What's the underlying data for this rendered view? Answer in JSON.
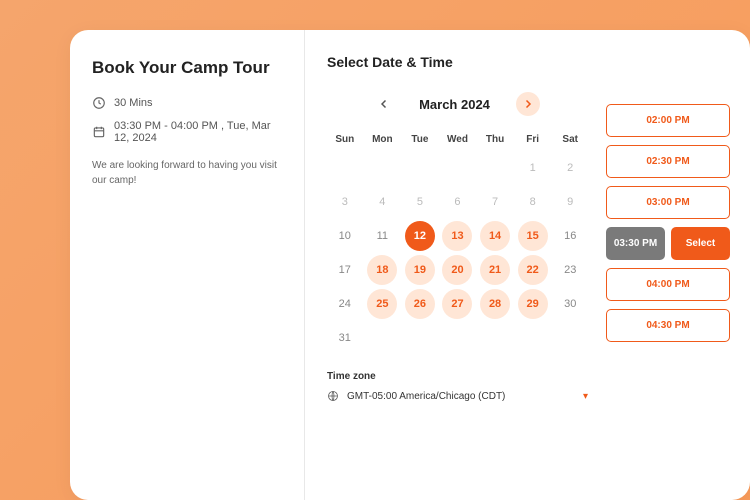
{
  "left": {
    "title": "Book Your Camp Tour",
    "duration": "30 Mins",
    "datetime": "03:30 PM - 04:00 PM , Tue, Mar 12, 2024",
    "desc": "We are looking forward to having you visit our camp!"
  },
  "right": {
    "heading": "Select Date & Time",
    "month": "March 2024",
    "weekdays": [
      "Sun",
      "Mon",
      "Tue",
      "Wed",
      "Thu",
      "Fri",
      "Sat"
    ],
    "tz_label": "Time zone",
    "tz_value": "GMT-05:00 America/Chicago (CDT)"
  },
  "days": [
    {
      "n": "",
      "cls": "empty"
    },
    {
      "n": "",
      "cls": "empty"
    },
    {
      "n": "",
      "cls": "empty"
    },
    {
      "n": "",
      "cls": "empty"
    },
    {
      "n": "",
      "cls": "empty"
    },
    {
      "n": "1",
      "cls": "muted"
    },
    {
      "n": "2",
      "cls": "muted"
    },
    {
      "n": "3",
      "cls": "muted"
    },
    {
      "n": "4",
      "cls": "muted"
    },
    {
      "n": "5",
      "cls": "muted"
    },
    {
      "n": "6",
      "cls": "muted"
    },
    {
      "n": "7",
      "cls": "muted"
    },
    {
      "n": "8",
      "cls": "muted"
    },
    {
      "n": "9",
      "cls": "muted"
    },
    {
      "n": "10",
      "cls": "normal"
    },
    {
      "n": "11",
      "cls": "normal"
    },
    {
      "n": "12",
      "cls": "selected"
    },
    {
      "n": "13",
      "cls": "avail"
    },
    {
      "n": "14",
      "cls": "avail"
    },
    {
      "n": "15",
      "cls": "avail"
    },
    {
      "n": "16",
      "cls": "normal"
    },
    {
      "n": "17",
      "cls": "normal"
    },
    {
      "n": "18",
      "cls": "avail"
    },
    {
      "n": "19",
      "cls": "avail"
    },
    {
      "n": "20",
      "cls": "avail"
    },
    {
      "n": "21",
      "cls": "avail"
    },
    {
      "n": "22",
      "cls": "avail"
    },
    {
      "n": "23",
      "cls": "normal"
    },
    {
      "n": "24",
      "cls": "normal"
    },
    {
      "n": "25",
      "cls": "avail"
    },
    {
      "n": "26",
      "cls": "avail"
    },
    {
      "n": "27",
      "cls": "avail"
    },
    {
      "n": "28",
      "cls": "avail"
    },
    {
      "n": "29",
      "cls": "avail"
    },
    {
      "n": "30",
      "cls": "normal"
    },
    {
      "n": "31",
      "cls": "normal"
    }
  ],
  "slots": [
    {
      "time": "02:00 PM",
      "selected": false
    },
    {
      "time": "02:30 PM",
      "selected": false
    },
    {
      "time": "03:00 PM",
      "selected": false
    },
    {
      "time": "03:30 PM",
      "selected": true,
      "btn": "Select"
    },
    {
      "time": "04:00 PM",
      "selected": false
    },
    {
      "time": "04:30 PM",
      "selected": false
    }
  ]
}
